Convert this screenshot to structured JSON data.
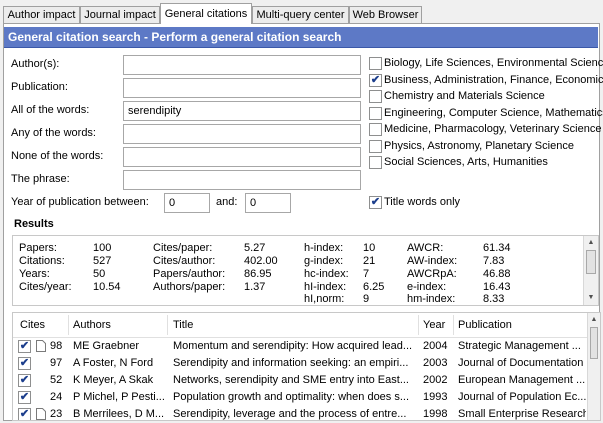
{
  "tabs": [
    "Author impact",
    "Journal impact",
    "General citations",
    "Multi-query center",
    "Web Browser"
  ],
  "header_title": "General citation search - Perform a general citation search",
  "form": {
    "authors_label": "Author(s):",
    "authors_value": "",
    "publication_label": "Publication:",
    "publication_value": "",
    "all_words_label": "All of the words:",
    "all_words_value": "serendipity",
    "any_words_label": "Any of the words:",
    "any_words_value": "",
    "none_words_label": "None of the words:",
    "none_words_value": "",
    "phrase_label": "The phrase:",
    "phrase_value": "",
    "year_label": "Year of publication between:",
    "year_from": "0",
    "and_label": "and:",
    "year_to": "0",
    "title_words_only_label": "Title words only",
    "title_words_only_checked": true
  },
  "subjects": [
    {
      "label": "Biology, Life Sciences, Environmental Science",
      "checked": false
    },
    {
      "label": "Business, Administration, Finance, Economics",
      "checked": true
    },
    {
      "label": "Chemistry and Materials Science",
      "checked": false
    },
    {
      "label": "Engineering, Computer Science, Mathematics",
      "checked": false
    },
    {
      "label": "Medicine, Pharmacology, Veterinary Science",
      "checked": false
    },
    {
      "label": "Physics, Astronomy, Planetary Science",
      "checked": false
    },
    {
      "label": "Social Sciences, Arts, Humanities",
      "checked": false
    }
  ],
  "results_heading": "Results",
  "metrics": {
    "papers_label": "Papers:",
    "papers": "100",
    "citations_label": "Citations:",
    "citations": "527",
    "years_label": "Years:",
    "years": "50",
    "cites_year_label": "Cites/year:",
    "cites_year": "10.54",
    "cites_paper_label": "Cites/paper:",
    "cites_paper": "5.27",
    "cites_author_label": "Cites/author:",
    "cites_author": "402.00",
    "papers_author_label": "Papers/author:",
    "papers_author": "86.95",
    "authors_paper_label": "Authors/paper:",
    "authors_paper": "1.37",
    "h_index_label": "h-index:",
    "h_index": "10",
    "g_index_label": "g-index:",
    "g_index": "21",
    "hc_index_label": "hc-index:",
    "hc_index": "7",
    "hi_index_label": "hI-index:",
    "hi_index": "6.25",
    "hi_norm_label": "hI,norm:",
    "hi_norm": "9",
    "awcr_label": "AWCR:",
    "awcr": "61.34",
    "aw_index_label": "AW-index:",
    "aw_index": "7.83",
    "awcrpa_label": "AWCRpA:",
    "awcrpa": "46.88",
    "e_index_label": "e-index:",
    "e_index": "16.43",
    "hm_index_label": "hm-index:",
    "hm_index": "8.33"
  },
  "table": {
    "columns": [
      "Cites",
      "Authors",
      "Title",
      "Year",
      "Publication"
    ],
    "rows": [
      {
        "checked": true,
        "cites": "98",
        "authors": "ME Graebner",
        "title": "Momentum and serendipity: How acquired lead...",
        "year": "2004",
        "publication": "Strategic Management ..."
      },
      {
        "checked": true,
        "cites": "97",
        "authors": "A Foster, N Ford",
        "title": "Serendipity and information seeking: an empiri...",
        "year": "2003",
        "publication": "Journal of Documentation"
      },
      {
        "checked": true,
        "cites": "52",
        "authors": "K Meyer, A Skak",
        "title": "Networks, serendipity and SME entry into East...",
        "year": "2002",
        "publication": "European Management ..."
      },
      {
        "checked": true,
        "cites": "24",
        "authors": "P Michel, P Pesti...",
        "title": "Population growth and optimality: when does s...",
        "year": "1993",
        "publication": "Journal of Population Ec..."
      },
      {
        "checked": true,
        "cites": "23",
        "authors": "B Merrilees, D M...",
        "title": "Serendipity, leverage and the process of entre...",
        "year": "1998",
        "publication": "Small Enterprise Research"
      }
    ]
  }
}
